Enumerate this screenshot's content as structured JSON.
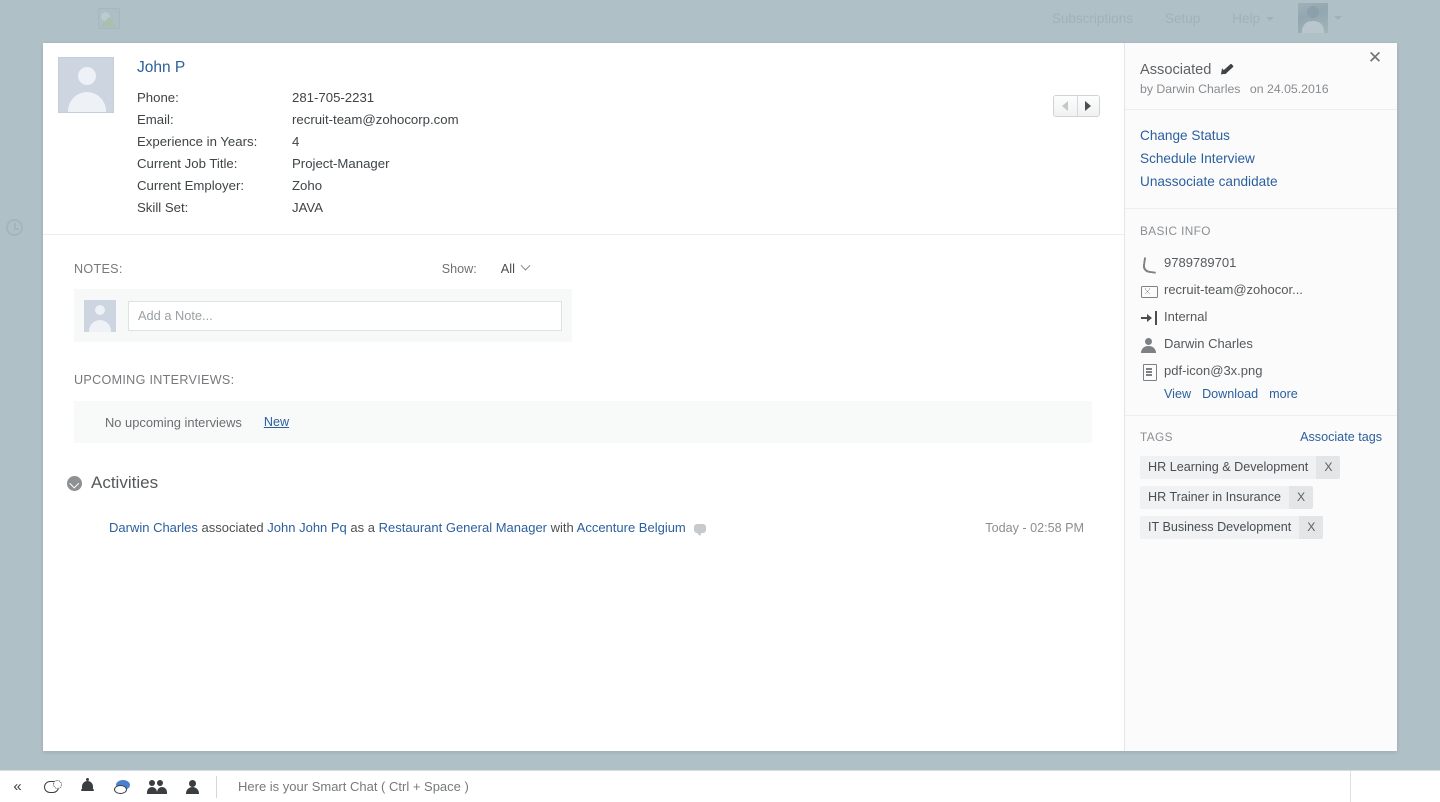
{
  "topbar": {
    "logo_icon": "broken-image-icon",
    "nav": [
      {
        "label": "Subscriptions",
        "caret": false
      },
      {
        "label": "Setup",
        "caret": false
      },
      {
        "label": "Help",
        "caret": true
      }
    ],
    "avatar_icon": "user-photo-avatar"
  },
  "candidate": {
    "name": "John P",
    "photo_icon": "person-placeholder-avatar",
    "fields": [
      {
        "label": "Phone:",
        "value": "281-705-2231"
      },
      {
        "label": "Email:",
        "value": "recruit-team@zohocorp.com"
      },
      {
        "label": "Experience in Years:",
        "value": "4"
      },
      {
        "label": "Current Job Title:",
        "value": "Project-Manager"
      },
      {
        "label": "Current Employer:",
        "value": "Zoho"
      },
      {
        "label": "Skill Set:",
        "value": "JAVA"
      }
    ],
    "pager": {
      "prev_icon": "arrow-left-icon",
      "next_icon": "arrow-right-icon"
    }
  },
  "notes": {
    "section_label": "NOTES:",
    "show_label": "Show:",
    "show_value": "All",
    "chevron_icon": "chevron-down-icon",
    "avatar_icon": "person-placeholder-avatar",
    "input_placeholder": "Add a Note...",
    "input_value": ""
  },
  "interviews": {
    "section_label": "UPCOMING INTERVIEWS:",
    "empty_text": "No upcoming interviews",
    "new_label": "New"
  },
  "activities": {
    "title": "Activities",
    "toggle_icon": "circle-chevron-down-icon",
    "rows": [
      {
        "actor": "Darwin Charles",
        "verb": "associated",
        "subject": "John John Pq",
        "connector": "as a",
        "role": "Restaurant General Manager",
        "with": "with",
        "company": "Accenture Belgium",
        "comment_icon": "comment-bubble-icon",
        "time": "Today - 02:58 PM"
      }
    ]
  },
  "sidebar": {
    "close_icon": "close-icon",
    "status_title": "Associated",
    "edit_icon": "pencil-icon",
    "status_by": "by Darwin Charles",
    "status_date": "on 24.05.2016",
    "links": [
      {
        "label": "Change Status"
      },
      {
        "label": "Schedule Interview"
      },
      {
        "label": "Unassociate candidate"
      }
    ],
    "basic_info_label": "BASIC INFO",
    "basic_info": [
      {
        "icon": "phone-icon",
        "value": "9789789701"
      },
      {
        "icon": "envelope-icon",
        "value": "recruit-team@zohocor..."
      },
      {
        "icon": "sign-in-arrow-icon",
        "value": "Internal"
      },
      {
        "icon": "person-icon",
        "value": "Darwin Charles"
      },
      {
        "icon": "document-icon",
        "value": "pdf-icon@3x.png"
      }
    ],
    "attachment_links": [
      {
        "label": "View"
      },
      {
        "label": "Download"
      },
      {
        "label": "more"
      }
    ],
    "tags_label": "TAGS",
    "associate_tags_label": "Associate tags",
    "tags": [
      {
        "name": "HR Learning & Development",
        "remove": "X"
      },
      {
        "name": "HR Trainer in Insurance",
        "remove": "X"
      },
      {
        "name": "IT Business Development",
        "remove": "X"
      }
    ]
  },
  "bottombar": {
    "icons": [
      {
        "name": "collapse-double-chevron-icon"
      },
      {
        "name": "chat-settings-icon"
      },
      {
        "name": "bell-icon"
      },
      {
        "name": "chat-bubble-icon"
      },
      {
        "name": "contacts-group-icon"
      },
      {
        "name": "person-icon"
      }
    ],
    "chat_text": "Here is your Smart Chat ( Ctrl + Space )"
  },
  "colors": {
    "link_blue": "#2b5f9e",
    "page_dim": "#b0c0c7",
    "card_white": "#ffffff",
    "sidebar_bg": "#fbfbfc"
  }
}
